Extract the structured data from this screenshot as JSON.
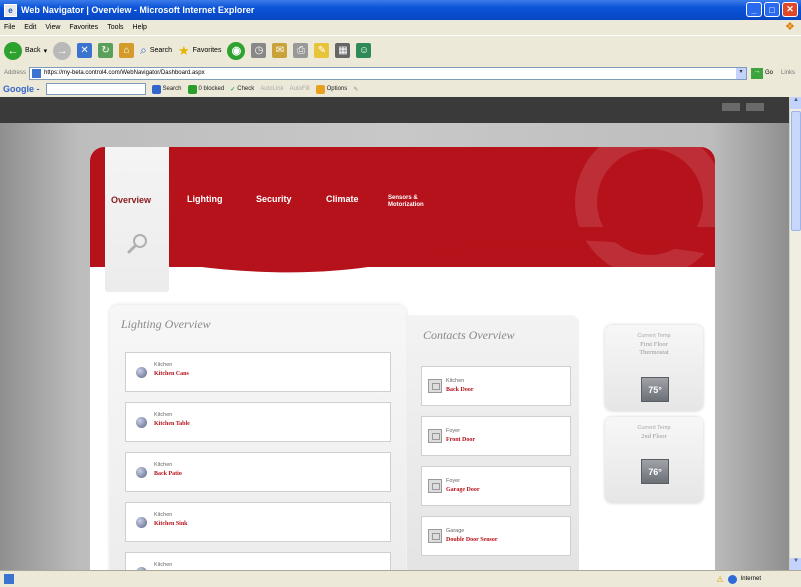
{
  "window": {
    "title": "Web Navigator | Overview - Microsoft Internet Explorer"
  },
  "menu": [
    "File",
    "Edit",
    "View",
    "Favorites",
    "Tools",
    "Help"
  ],
  "toolbar": {
    "back": "Back",
    "search": "Search",
    "favorites": "Favorites"
  },
  "address": {
    "label": "Address",
    "url": "https://my-beta.control4.com/WebNavigator/Dashboard.aspx",
    "go": "Go",
    "links": "Links"
  },
  "google": {
    "logo": "Google -",
    "search": "Search",
    "blocked": "0 blocked",
    "check": "Check",
    "autolink": "AutoLink",
    "autofill": "AutoFill",
    "options": "Options"
  },
  "nav": {
    "overview": "Overview",
    "lighting": "Lighting",
    "security": "Security",
    "climate": "Climate",
    "sensors_line1": "Sensors &",
    "sensors_line2": "Motorization"
  },
  "lighting_overview": {
    "title": "Lighting Overview",
    "items": [
      {
        "room": "Kitchen",
        "name": "Kitchen Cans"
      },
      {
        "room": "Kitchen",
        "name": "Kitchen Table"
      },
      {
        "room": "Kitchen",
        "name": "Back Patio"
      },
      {
        "room": "Kitchen",
        "name": "Kitchen Sink"
      },
      {
        "room": "Kitchen",
        "name": ""
      }
    ]
  },
  "contacts_overview": {
    "title": "Contacts Overview",
    "items": [
      {
        "room": "Kitchen",
        "name": "Back Door"
      },
      {
        "room": "Foyer",
        "name": "Front Door"
      },
      {
        "room": "Foyer",
        "name": "Garage Door"
      },
      {
        "room": "Garage",
        "name": "Double Door Sensor"
      }
    ]
  },
  "thermostats": [
    {
      "label": "Current Temp",
      "name_line1": "First Floor",
      "name_line2": "Thermostat",
      "value": "75°"
    },
    {
      "label": "Current Temp",
      "name_line1": "2nd Floor",
      "name_line2": "",
      "value": "76°"
    }
  ],
  "status": {
    "zone": "Internet"
  },
  "colors": {
    "brand_red": "#b5121b",
    "xp_blue": "#0a53d8"
  }
}
